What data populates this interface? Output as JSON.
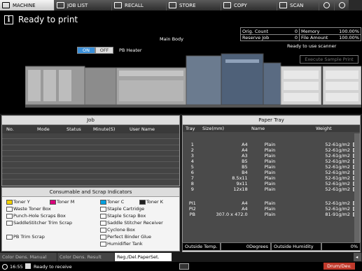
{
  "tabs": [
    {
      "label": "MACHINE",
      "icon": "machine-icon"
    },
    {
      "label": "JOB LIST",
      "icon": "job-list-icon"
    },
    {
      "label": "RECALL",
      "icon": "recall-icon"
    },
    {
      "label": "STORE",
      "icon": "store-icon"
    },
    {
      "label": "COPY",
      "icon": "copy-icon"
    },
    {
      "label": "SCAN",
      "icon": "scan-icon"
    }
  ],
  "status": {
    "message": "Ready to print",
    "main_body": "Main Body",
    "scanner": "Ready to use scanner",
    "sample_button": "Execute Sample Print",
    "pb_heater": "PB Heater",
    "on": "ON",
    "off": "OFF"
  },
  "counters": {
    "orig_count_label": "Orig. Count",
    "orig_count": "0",
    "memory_label": "Memory",
    "memory": "100.00%",
    "reserve_job_label": "Reserve Job",
    "reserve_job": "0",
    "file_amount_label": "File Amount",
    "file_amount": "100.00%"
  },
  "job": {
    "title": "Job",
    "columns": [
      "No.",
      "Mode",
      "Status",
      "Minute(S)",
      "User Name"
    ]
  },
  "consumables": {
    "title": "Consumable and Scrap Indicators",
    "items": [
      "Toner Y",
      "Toner M",
      "Toner C",
      "Toner K",
      "Waste Toner Box",
      "Staple Cartridge",
      "Punch-Hole Scraps Box",
      "Staple Scrap Box",
      "SaddleStitcher Trim Scrap",
      "Saddle Stitcher Receiver",
      "Cyclone Box",
      "PB Trim Scrap",
      "Perfect Binder Glue",
      "Humidifier Tank"
    ]
  },
  "tray": {
    "title": "Paper Tray",
    "columns": [
      "Tray",
      "Size(mm)",
      "Name",
      "Weight"
    ],
    "rows": [
      {
        "tray": "1",
        "size": "A4",
        "name": "Plain",
        "weight": "52-61g/m2"
      },
      {
        "tray": "2",
        "size": "A4",
        "name": "Plain",
        "weight": "52-61g/m2"
      },
      {
        "tray": "3",
        "size": "A3",
        "name": "Plain",
        "weight": "52-61g/m2"
      },
      {
        "tray": "4",
        "size": "B5",
        "name": "Plain",
        "weight": "52-61g/m2"
      },
      {
        "tray": "5",
        "size": "B5",
        "name": "Plain",
        "weight": "52-61g/m2"
      },
      {
        "tray": "6",
        "size": "B4",
        "name": "Plain",
        "weight": "52-61g/m2"
      },
      {
        "tray": "7",
        "size": "8.5x11",
        "name": "Plain",
        "weight": "52-61g/m2"
      },
      {
        "tray": "8",
        "size": "9x11",
        "name": "Plain",
        "weight": "52-61g/m2"
      },
      {
        "tray": "9",
        "size": "12x18",
        "name": "Plain",
        "weight": "52-61g/m2"
      },
      {
        "tray": "PI1",
        "size": "A4",
        "name": "Plain",
        "weight": "52-61g/m2"
      },
      {
        "tray": "PI2",
        "size": "A4",
        "name": "Plain",
        "weight": "52-61g/m2"
      },
      {
        "tray": "PB",
        "size": "307.0 x 472.0",
        "name": "Plain",
        "weight": "81-91g/m2"
      }
    ]
  },
  "outside": {
    "temp_label": "Outside Temp.",
    "temp": "0Degrees",
    "humidity_label": "Outside Humidity",
    "humidity": "0%"
  },
  "bottom_tabs": [
    "Color Dens. Manual",
    "Color Dens. Result",
    "Reg./Del.PaperSet."
  ],
  "statusbar": {
    "time": "16:55",
    "message": "Ready to receive",
    "drum": "Drum/Dev."
  }
}
